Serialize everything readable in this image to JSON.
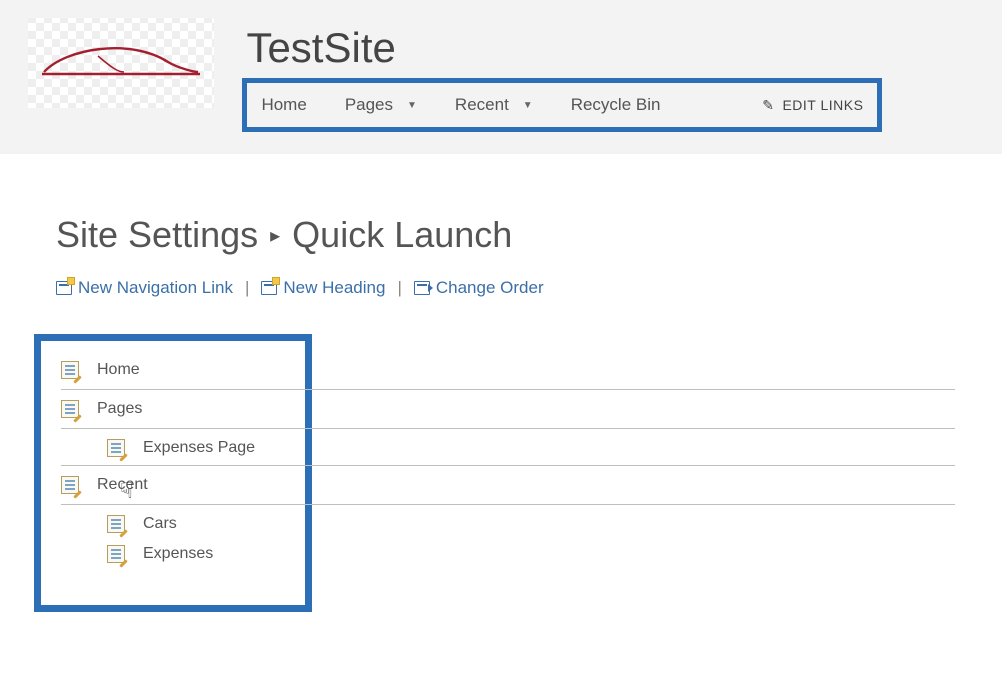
{
  "site": {
    "title": "TestSite"
  },
  "topnav": {
    "items": [
      {
        "label": "Home",
        "hasMenu": false
      },
      {
        "label": "Pages",
        "hasMenu": true
      },
      {
        "label": "Recent",
        "hasMenu": true
      },
      {
        "label": "Recycle Bin",
        "hasMenu": false
      }
    ],
    "editLinks": "EDIT LINKS"
  },
  "breadcrumb": {
    "parent": "Site Settings",
    "current": "Quick Launch"
  },
  "actions": {
    "newLink": "New Navigation Link",
    "newHeading": "New Heading",
    "changeOrder": "Change Order"
  },
  "quickLaunch": [
    {
      "type": "heading",
      "label": "Home"
    },
    {
      "type": "heading",
      "label": "Pages"
    },
    {
      "type": "child",
      "label": "Expenses Page"
    },
    {
      "type": "heading",
      "label": "Recent"
    },
    {
      "type": "child",
      "label": "Cars"
    },
    {
      "type": "child",
      "label": "Expenses"
    }
  ]
}
